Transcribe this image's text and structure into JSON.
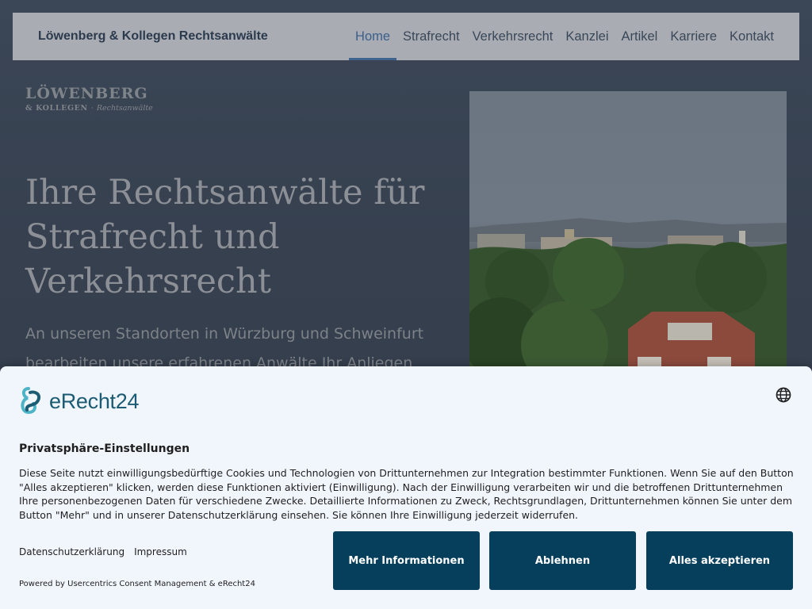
{
  "header": {
    "brand": "Löwenberg & Kollegen Rechtsanwälte",
    "nav": [
      {
        "label": "Home",
        "active": true
      },
      {
        "label": "Strafrecht"
      },
      {
        "label": "Verkehrsrecht"
      },
      {
        "label": "Kanzlei"
      },
      {
        "label": "Artikel"
      },
      {
        "label": "Karriere"
      },
      {
        "label": "Kontakt"
      }
    ]
  },
  "logo": {
    "main": "LÖWENBERG",
    "sub_amp": "& KOLLEGEN",
    "sub_sep": "·",
    "sub_tag": "Rechtsanwälte"
  },
  "hero": {
    "title": "Ihre Rechtsanwälte für Strafrecht und Verkehrsrecht",
    "text": "An unseren Standorten in Würzburg und Schweinfurt bearbeiten unsere erfahrenen Anwälte Ihr Anliegen"
  },
  "consent": {
    "logo_text": "eRecht24",
    "title": "Privatsphäre-Einstellungen",
    "text": "Diese Seite nutzt einwilligungsbedürftige Cookies und Technologien von Drittunternehmen zur Integration bestimmter Funktionen. Wenn Sie auf den Button \"Alles akzeptieren\" klicken, werden diese Funktionen aktiviert (Einwilligung). Nach der Einwilligung verarbeiten wir und die betroffenen Drittunternehmen Ihre personenbezogenen Daten für verschiedene Zwecke. Detaillierte Informationen zu Zweck, Rechtsgrundlagen, Drittunternehmen können Sie unter dem Button \"Mehr\" und in unserer Datenschutzerklärung einsehen. Sie können Ihre Einwilligung jederzeit widerrufen.",
    "links": {
      "privacy": "Datenschutzerklärung",
      "imprint": "Impressum"
    },
    "powered_by": "Powered by Usercentrics Consent Management & eRecht24",
    "buttons": {
      "more": "Mehr Informationen",
      "deny": "Ablehnen",
      "accept": "Alles akzeptieren"
    },
    "icons": {
      "language": "globe-icon",
      "brand": "erecht24-logo-icon"
    }
  },
  "colors": {
    "accent": "#063f5c",
    "nav_active": "#3f628f",
    "brand": "#1b5b73"
  }
}
